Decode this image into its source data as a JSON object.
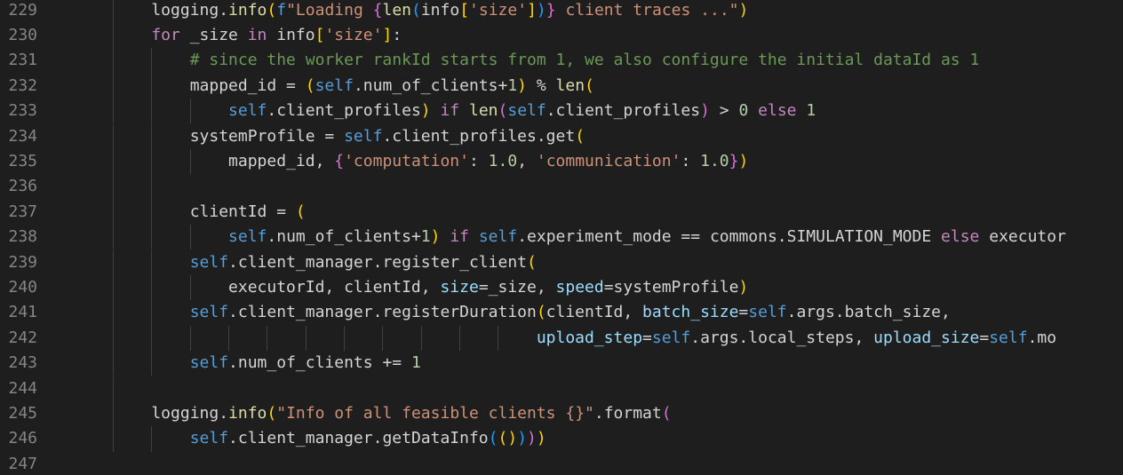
{
  "colors": {
    "background": "#1e1e1e",
    "line_number": "#858585",
    "default": "#d4d4d4",
    "function": "#dcdcaa",
    "string": "#ce9178",
    "keyword": "#c586c0",
    "self": "#569cd6",
    "variable": "#9cdcfe",
    "number": "#b5cea8",
    "comment": "#6a9955",
    "bracket_gold": "#ffd700",
    "bracket_pink": "#da70d6",
    "bracket_blue": "#179fff",
    "indent_guide": "#404040"
  },
  "lines": [
    {
      "num": "229",
      "indent": 2,
      "tokens": [
        [
          "logging.",
          "d"
        ],
        [
          "info",
          "fn"
        ],
        [
          "(",
          "b1"
        ],
        [
          "f",
          "self"
        ],
        [
          "\"Loading ",
          "str"
        ],
        [
          "{",
          "b2"
        ],
        [
          "len",
          "fn"
        ],
        [
          "(",
          "b3"
        ],
        [
          "info",
          "d"
        ],
        [
          "[",
          "b1"
        ],
        [
          "'size'",
          "str"
        ],
        [
          "]",
          "b1"
        ],
        [
          ")",
          "b3"
        ],
        [
          "}",
          "b2"
        ],
        [
          " client traces ...\"",
          "str"
        ],
        [
          ")",
          "b1"
        ]
      ]
    },
    {
      "num": "230",
      "indent": 2,
      "tokens": [
        [
          "for",
          "kw"
        ],
        [
          " _size ",
          "d"
        ],
        [
          "in",
          "kw"
        ],
        [
          " info",
          "d"
        ],
        [
          "[",
          "b1"
        ],
        [
          "'size'",
          "str"
        ],
        [
          "]",
          "b1"
        ],
        [
          ":",
          "d"
        ]
      ]
    },
    {
      "num": "231",
      "indent": 3,
      "tokens": [
        [
          "# since the worker rankId starts from 1, we also configure the initial dataId as 1",
          "cm"
        ]
      ]
    },
    {
      "num": "232",
      "indent": 3,
      "tokens": [
        [
          "mapped_id = ",
          "d"
        ],
        [
          "(",
          "b1"
        ],
        [
          "self",
          "self"
        ],
        [
          ".num_of_clients+",
          "d"
        ],
        [
          "1",
          "num"
        ],
        [
          ")",
          "b1"
        ],
        [
          " % ",
          "d"
        ],
        [
          "len",
          "fn"
        ],
        [
          "(",
          "b1"
        ]
      ]
    },
    {
      "num": "233",
      "indent": 4,
      "tokens": [
        [
          "self",
          "self"
        ],
        [
          ".client_profiles",
          "d"
        ],
        [
          ")",
          "b1"
        ],
        [
          " ",
          "d"
        ],
        [
          "if",
          "kw"
        ],
        [
          " ",
          "d"
        ],
        [
          "len",
          "fn"
        ],
        [
          "(",
          "b2"
        ],
        [
          "self",
          "self"
        ],
        [
          ".client_profiles",
          "d"
        ],
        [
          ")",
          "b2"
        ],
        [
          " > ",
          "d"
        ],
        [
          "0",
          "num"
        ],
        [
          " ",
          "d"
        ],
        [
          "else",
          "kw"
        ],
        [
          " ",
          "d"
        ],
        [
          "1",
          "num"
        ]
      ]
    },
    {
      "num": "234",
      "indent": 3,
      "tokens": [
        [
          "systemProfile = ",
          "d"
        ],
        [
          "self",
          "self"
        ],
        [
          ".client_profiles.get",
          "d"
        ],
        [
          "(",
          "b1"
        ]
      ]
    },
    {
      "num": "235",
      "indent": 4,
      "tokens": [
        [
          "mapped_id, ",
          "d"
        ],
        [
          "{",
          "b2"
        ],
        [
          "'computation'",
          "str"
        ],
        [
          ": ",
          "d"
        ],
        [
          "1.0",
          "num"
        ],
        [
          ", ",
          "d"
        ],
        [
          "'communication'",
          "str"
        ],
        [
          ": ",
          "d"
        ],
        [
          "1.0",
          "num"
        ],
        [
          "}",
          "b2"
        ],
        [
          ")",
          "b1"
        ]
      ]
    },
    {
      "num": "236",
      "indent": 3,
      "tokens": []
    },
    {
      "num": "237",
      "indent": 3,
      "tokens": [
        [
          "clientId = ",
          "d"
        ],
        [
          "(",
          "b1"
        ]
      ]
    },
    {
      "num": "238",
      "indent": 4,
      "tokens": [
        [
          "self",
          "self"
        ],
        [
          ".num_of_clients+",
          "d"
        ],
        [
          "1",
          "num"
        ],
        [
          ")",
          "b1"
        ],
        [
          " ",
          "d"
        ],
        [
          "if",
          "kw"
        ],
        [
          " ",
          "d"
        ],
        [
          "self",
          "self"
        ],
        [
          ".experiment_mode == commons.SIMULATION_MODE ",
          "d"
        ],
        [
          "else",
          "kw"
        ],
        [
          " executor",
          "d"
        ]
      ]
    },
    {
      "num": "239",
      "indent": 3,
      "tokens": [
        [
          "self",
          "self"
        ],
        [
          ".client_manager.register_client",
          "d"
        ],
        [
          "(",
          "b1"
        ]
      ]
    },
    {
      "num": "240",
      "indent": 4,
      "tokens": [
        [
          "executorId, clientId, ",
          "d"
        ],
        [
          "size",
          "var"
        ],
        [
          "=_size, ",
          "d"
        ],
        [
          "speed",
          "var"
        ],
        [
          "=systemProfile",
          "d"
        ],
        [
          ")",
          "b1"
        ]
      ]
    },
    {
      "num": "241",
      "indent": 3,
      "tokens": [
        [
          "self",
          "self"
        ],
        [
          ".client_manager.registerDuration",
          "d"
        ],
        [
          "(",
          "b1"
        ],
        [
          "clientId, ",
          "d"
        ],
        [
          "batch_size",
          "var"
        ],
        [
          "=",
          "d"
        ],
        [
          "self",
          "self"
        ],
        [
          ".args.batch_size,",
          "d"
        ]
      ]
    },
    {
      "num": "242",
      "indent": 12,
      "tokens": [
        [
          "upload_step",
          "var"
        ],
        [
          "=",
          "d"
        ],
        [
          "self",
          "self"
        ],
        [
          ".args.local_steps, ",
          "d"
        ],
        [
          "upload_size",
          "var"
        ],
        [
          "=",
          "d"
        ],
        [
          "self",
          "self"
        ],
        [
          ".mo",
          "d"
        ]
      ]
    },
    {
      "num": "243",
      "indent": 3,
      "tokens": [
        [
          "self",
          "self"
        ],
        [
          ".num_of_clients += ",
          "d"
        ],
        [
          "1",
          "num"
        ]
      ]
    },
    {
      "num": "244",
      "indent": 2,
      "tokens": []
    },
    {
      "num": "245",
      "indent": 2,
      "tokens": [
        [
          "logging.",
          "d"
        ],
        [
          "info",
          "fn"
        ],
        [
          "(",
          "b1"
        ],
        [
          "\"Info of all feasible clients {}\"",
          "str"
        ],
        [
          ".format",
          "d"
        ],
        [
          "(",
          "b2"
        ]
      ]
    },
    {
      "num": "246",
      "indent": 3,
      "tokens": [
        [
          "self",
          "self"
        ],
        [
          ".client_manager.getDataInfo",
          "d"
        ],
        [
          "(",
          "b3"
        ],
        [
          "()",
          "b1"
        ],
        [
          ")",
          "b3"
        ],
        [
          ")",
          "b2"
        ],
        [
          ")",
          "b1"
        ]
      ]
    },
    {
      "num": "247",
      "indent": 1,
      "tokens": []
    }
  ]
}
